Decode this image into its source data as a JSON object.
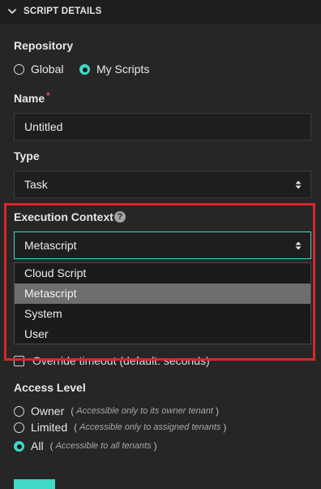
{
  "header": {
    "title": "SCRIPT DETAILS"
  },
  "repository": {
    "label": "Repository",
    "options": [
      {
        "label": "Global",
        "selected": false
      },
      {
        "label": "My Scripts",
        "selected": true
      }
    ]
  },
  "name": {
    "label": "Name",
    "required_mark": "*",
    "value": "Untitled"
  },
  "type": {
    "label": "Type",
    "value": "Task"
  },
  "execution_context": {
    "label": "Execution Context",
    "help_glyph": "?",
    "value": "Metascript",
    "options": [
      "Cloud Script",
      "Metascript",
      "System",
      "User"
    ],
    "highlighted_option": "Metascript"
  },
  "override_timeout": {
    "label": "Override timeout (default: seconds)",
    "checked": false
  },
  "access_level": {
    "label": "Access Level",
    "options": [
      {
        "label": "Owner",
        "hint": "Accessible only to its owner tenant",
        "selected": false
      },
      {
        "label": "Limited",
        "hint": "Accessible only to assigned tenants",
        "selected": false
      },
      {
        "label": "All",
        "hint": "Accessible to all tenants",
        "selected": true
      }
    ]
  },
  "colors": {
    "accent": "#3fd9c6",
    "highlight_box": "#d9262b",
    "required": "#e5484d"
  }
}
